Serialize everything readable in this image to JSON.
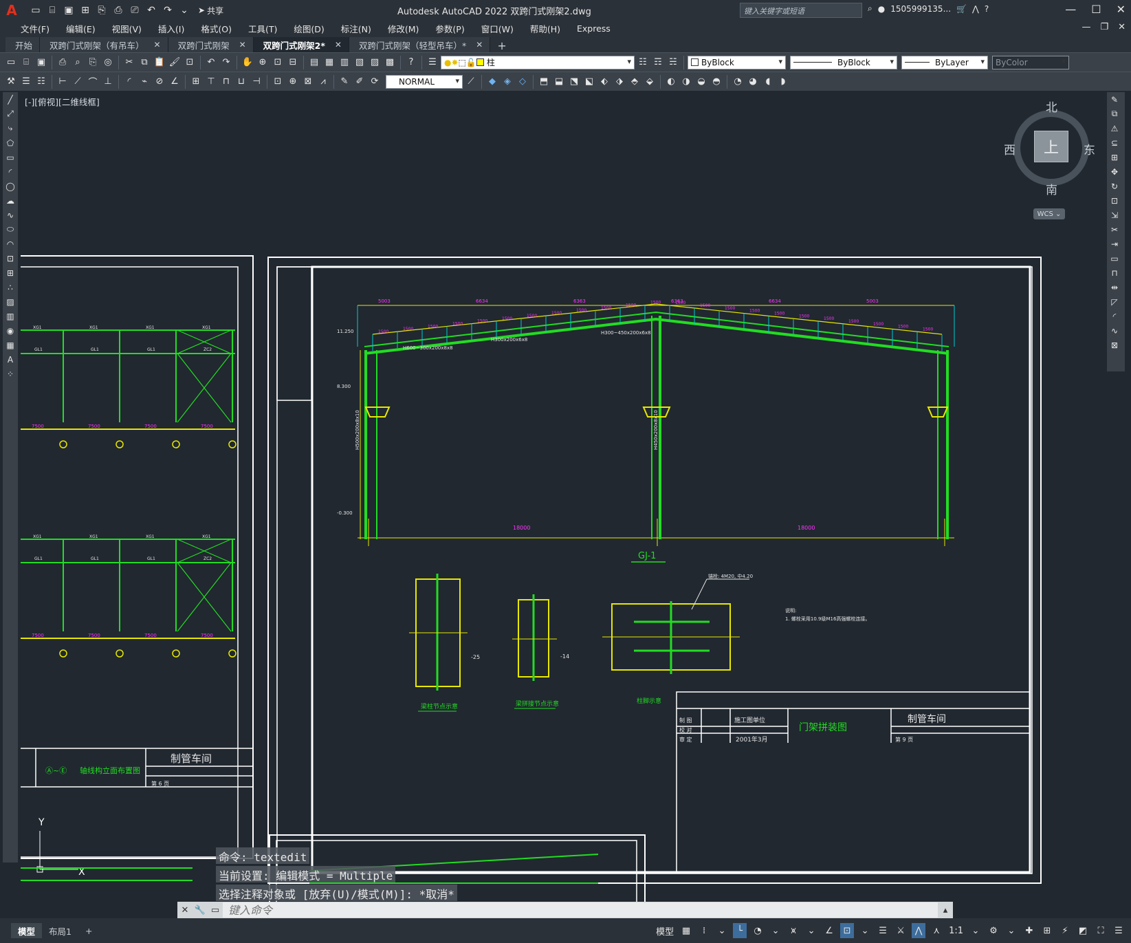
{
  "window": {
    "app_logo": "A",
    "title": "Autodesk AutoCAD 2022    双跨门式刚架2.dwg",
    "share_label": "共享",
    "search_placeholder": "键入关键字或短语",
    "username": "1505999135...",
    "help": "?"
  },
  "menu": [
    "文件(F)",
    "编辑(E)",
    "视图(V)",
    "插入(I)",
    "格式(O)",
    "工具(T)",
    "绘图(D)",
    "标注(N)",
    "修改(M)",
    "参数(P)",
    "窗口(W)",
    "帮助(H)",
    "Express"
  ],
  "tabs": [
    {
      "label": "开始",
      "closable": false,
      "active": false
    },
    {
      "label": "双跨门式刚架（有吊车）",
      "closable": true,
      "active": false
    },
    {
      "label": "双跨门式刚架",
      "closable": true,
      "active": false
    },
    {
      "label": "双跨门式刚架2*",
      "closable": true,
      "active": true
    },
    {
      "label": "双跨门式刚架（轻型吊车）*",
      "closable": true,
      "active": false
    }
  ],
  "properties": {
    "layer": "柱",
    "color": "ByBlock",
    "linetype": "ByBlock",
    "lineweight": "ByLayer",
    "plotstyle": "ByColor",
    "dimstyle": "NORMAL"
  },
  "viewport_label": "[-][俯视][二维线框]",
  "viewcube": {
    "north": "北",
    "south": "南",
    "east": "东",
    "west": "西",
    "face": "上",
    "wcs": "WCS"
  },
  "drawing": {
    "frame_title": "GJ-1",
    "detail_1": "梁柱节点示意",
    "detail_2": "梁拼接节点示意",
    "detail_3": "柱脚示意",
    "plate_1": "-25",
    "plate_2": "-14",
    "notes_heading": "说明:",
    "notes_text": "1. 螺栓采用10.9级M16高强螺栓连接。",
    "anchor_note": "锚栓: 4M20, 中4.20",
    "span_left": "18000",
    "span_right": "18000",
    "top_dims": [
      "5003",
      "6634",
      "6363",
      "6363",
      "6634",
      "5003"
    ],
    "purlin_dims": [
      "1500",
      "1500",
      "1500",
      "1500",
      "1500",
      "1500",
      "1500",
      "1500",
      "1500",
      "1500",
      "1500",
      "1500",
      "1500",
      "1500",
      "1500",
      "1500",
      "1500",
      "1500",
      "1500",
      "1500",
      "1500",
      "1500",
      "1500",
      "1500"
    ],
    "elev_top": "11.250",
    "elev_mid": "8.300",
    "elev_base": "-0.300",
    "section_left": "H600~300x200x8x8",
    "section_mid": "H300x200x6x8",
    "section_right": "H300~450x200x6x8",
    "col_left": "H500x200x8x10",
    "col_mid": "H450x200x8x10",
    "workshop": "制管车间",
    "drawing_name": "门架拼装图",
    "date": "2001年3月",
    "design_unit": "施工图单位",
    "left_sheet_name": "轴线构立面布置图",
    "left_sheet_axes": "Ⓐ~Ⓔ",
    "tb_rows": [
      "制 图",
      "校 对",
      "审 定"
    ],
    "sheet_no": "第 9 页",
    "left_sheet_no": "第 6 页",
    "bays": [
      "7500",
      "7500",
      "7500",
      "7500"
    ],
    "brace_labels": [
      "XG1",
      "XG1",
      "XG1",
      "XG1"
    ],
    "beam_labels": [
      "GL1",
      "GL1",
      "GL1",
      "ZC2"
    ]
  },
  "command": {
    "history": [
      "命令:  textedit",
      "当前设置: 编辑模式 = Multiple",
      "选择注释对象或 [放弃(U)/模式(M)]: *取消*"
    ],
    "placeholder": "键入命令"
  },
  "layout_tabs": [
    "模型",
    "布局1"
  ],
  "status": {
    "model": "模型",
    "scale": "1:1"
  },
  "colors": {
    "canvas": "#212830",
    "frame_green": "#22dd22",
    "dim_yellow": "#e8e800",
    "dim_cyan": "#00cccc",
    "text_magenta": "#ff33ff",
    "white": "#ffffff"
  }
}
